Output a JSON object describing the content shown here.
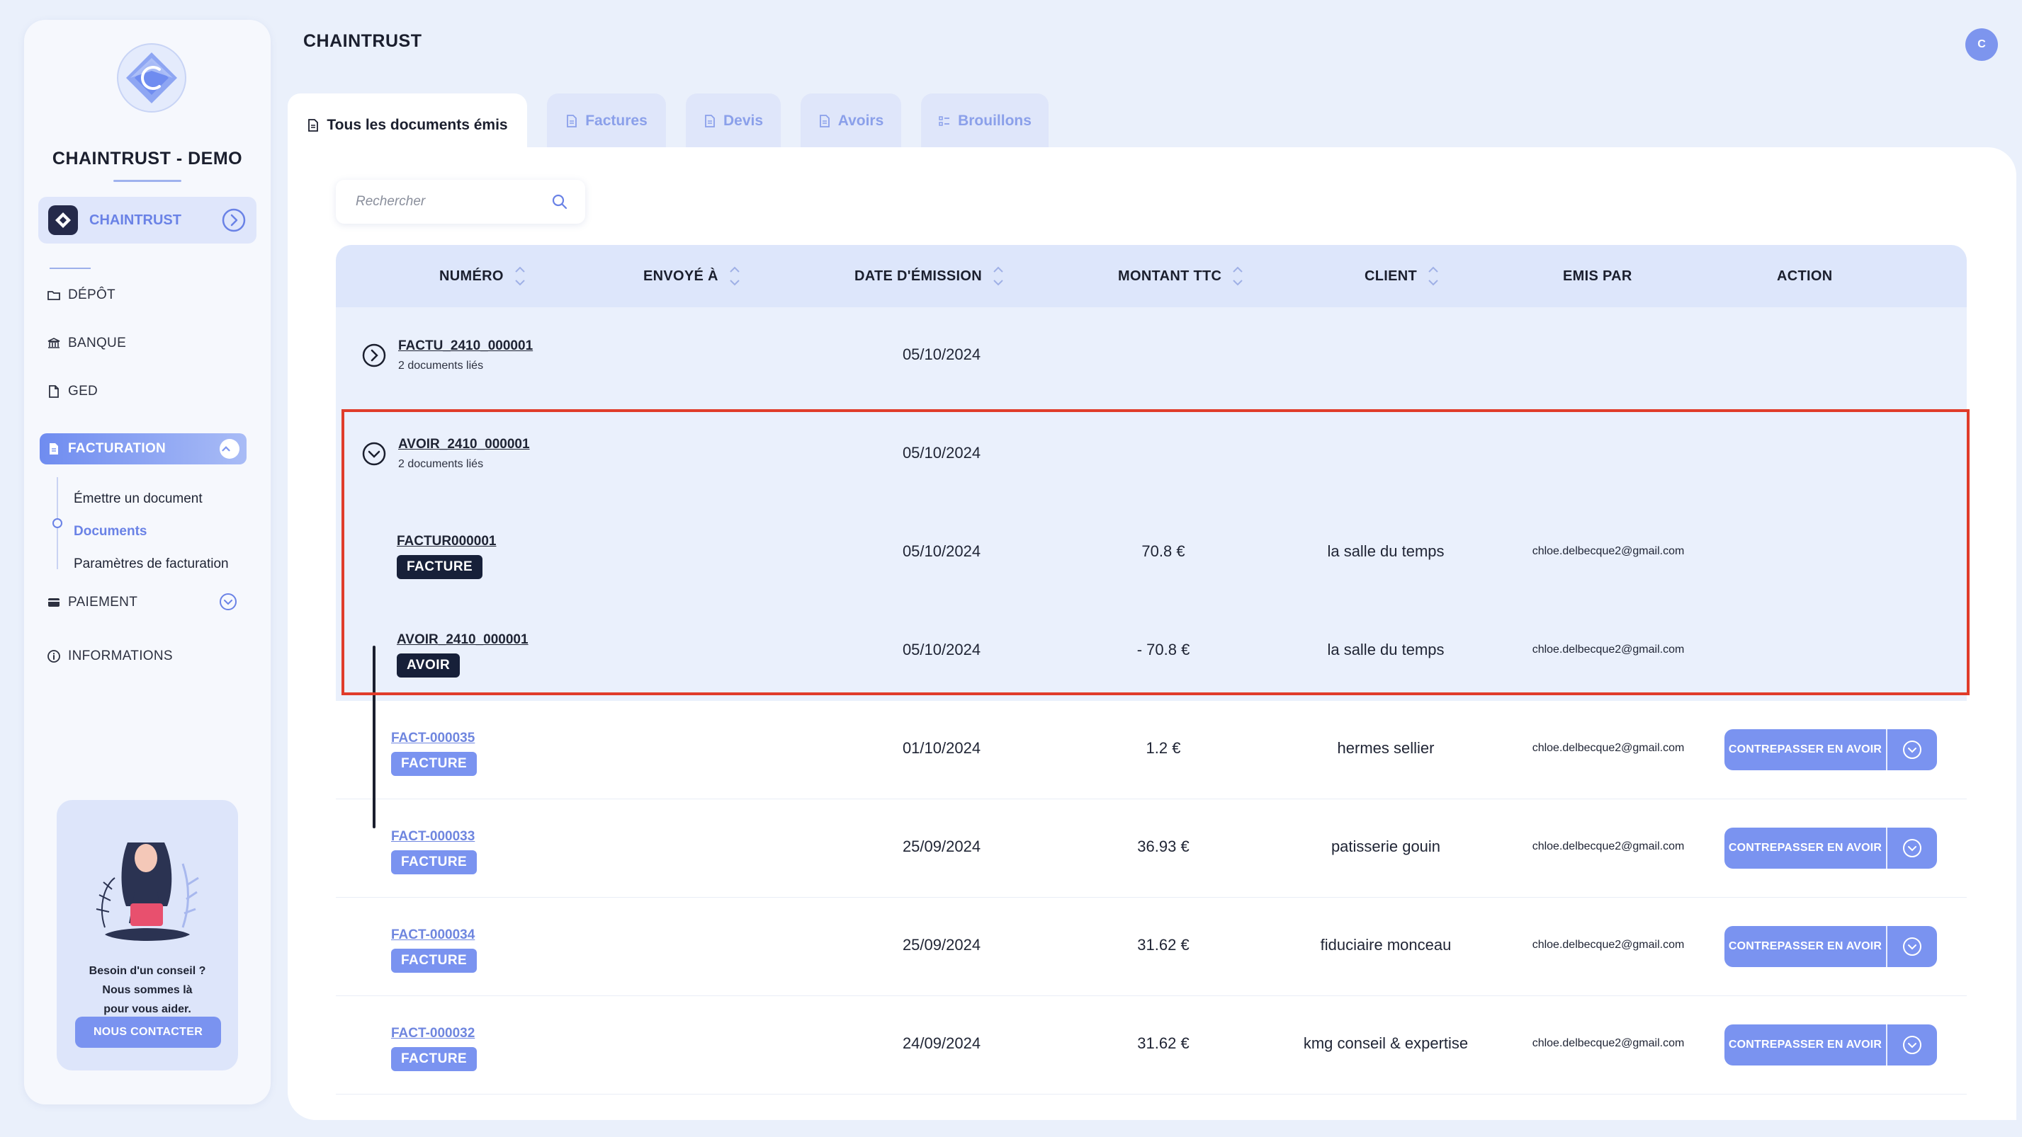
{
  "sidebar": {
    "brand": "CHAINTRUST - DEMO",
    "company": "CHAINTRUST",
    "nav": {
      "depot": "DÉPÔT",
      "banque": "BANQUE",
      "ged": "GED",
      "facturation": "FACTURATION",
      "paiement": "PAIEMENT",
      "informations": "INFORMATIONS"
    },
    "sub": [
      "Émettre un document",
      "Documents",
      "Paramètres de facturation"
    ],
    "help": {
      "line1": "Besoin d'un conseil ?",
      "line2": "Nous sommes là",
      "line3": "pour vous aider.",
      "button": "NOUS CONTACTER"
    }
  },
  "header": {
    "title": "CHAINTRUST",
    "avatar": "C"
  },
  "tabs": [
    "Tous les documents émis",
    "Factures",
    "Devis",
    "Avoirs",
    "Brouillons"
  ],
  "search": {
    "placeholder": "Rechercher"
  },
  "table": {
    "columns": [
      "NUMÉRO",
      "ENVOYÉ À",
      "DATE D'ÉMISSION",
      "MONTANT TTC",
      "CLIENT",
      "EMIS PAR",
      "ACTION"
    ],
    "action_label": "CONTREPASSER EN AVOIR",
    "rows": [
      {
        "numero": "FACTU_2410_000001",
        "linked": "2 documents liés",
        "date": "05/10/2024"
      },
      {
        "numero": "AVOIR_2410_000001",
        "linked": "2 documents liés",
        "date": "05/10/2024"
      },
      {
        "numero": "FACTUR000001",
        "badge": "FACTURE",
        "date": "05/10/2024",
        "montant": "70.8 €",
        "client": "la salle du temps",
        "emis_par": "chloe.delbecque2@gmail.com"
      },
      {
        "numero": "AVOIR_2410_000001",
        "badge": "AVOIR",
        "date": "05/10/2024",
        "montant": "- 70.8 €",
        "client": "la salle du temps",
        "emis_par": "chloe.delbecque2@gmail.com"
      },
      {
        "numero": "FACT-000035",
        "badge": "FACTURE",
        "date": "01/10/2024",
        "montant": "1.2 €",
        "client": "hermes sellier",
        "emis_par": "chloe.delbecque2@gmail.com"
      },
      {
        "numero": "FACT-000033",
        "badge": "FACTURE",
        "date": "25/09/2024",
        "montant": "36.93 €",
        "client": "patisserie gouin",
        "emis_par": "chloe.delbecque2@gmail.com"
      },
      {
        "numero": "FACT-000034",
        "badge": "FACTURE",
        "date": "25/09/2024",
        "montant": "31.62 €",
        "client": "fiduciaire monceau",
        "emis_par": "chloe.delbecque2@gmail.com"
      },
      {
        "numero": "FACT-000032",
        "badge": "FACTURE",
        "date": "24/09/2024",
        "montant": "31.62 €",
        "client": "kmg conseil & expertise",
        "emis_par": "chloe.delbecque2@gmail.com"
      }
    ]
  },
  "colors": {
    "accent": "#7a93f0",
    "dark_badge": "#172039",
    "highlight": "#e03c2a",
    "background": "#eaf0fb"
  }
}
